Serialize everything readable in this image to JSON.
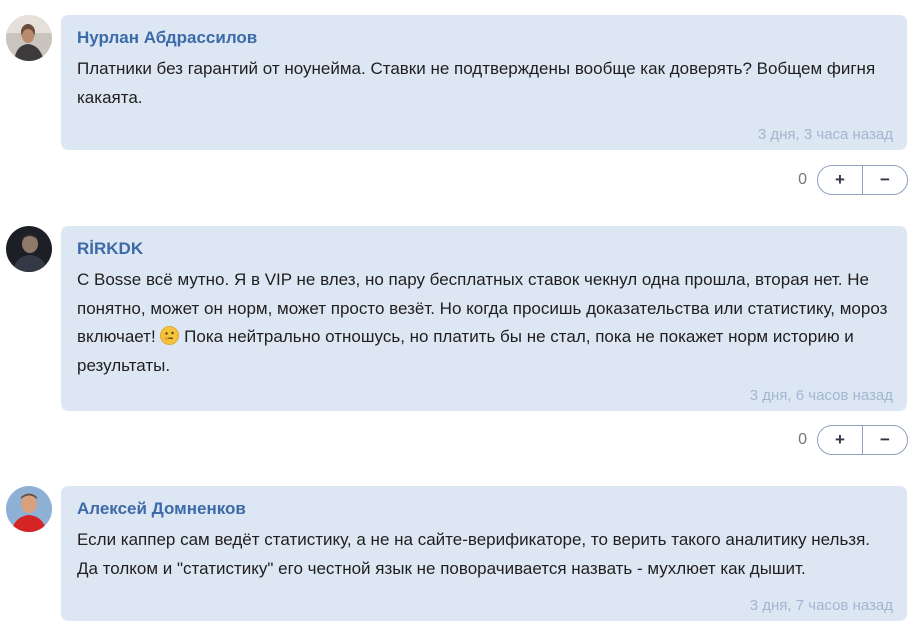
{
  "comments": [
    {
      "author": "Нурлан Абдрассилов",
      "text": "Платники без гарантий от ноунейма. Ставки не подтверждены вообще как доверять? Вобщем фигня какаята.",
      "time": "3 дня, 3 часа назад",
      "score": "0",
      "plus": "+",
      "minus": "−",
      "avatar_icon": "avatar-photo-icon"
    },
    {
      "author": "RİRKDK",
      "text_before": "С Bosse всё мутно. Я в VIP не влез, но пару бесплатных ставок чекнул одна прошла, вторая нет. Не понятно, может он норм, может просто везёт. Но когда просишь доказательства или статистику, мороз включает!",
      "emoji": "thinking-face-emoji",
      "text_after": "Пока нейтрально отношусь, но платить бы не стал, пока не покажет норм историю и результаты.",
      "time": "3 дня, 6 часов назад",
      "score": "0",
      "plus": "+",
      "minus": "−",
      "avatar_icon": "avatar-photo-icon"
    },
    {
      "author": "Алексей Домненков",
      "text": "Если каппер сам ведёт статистику, а не на сайте-верификаторе, то верить такого аналитику нельзя. Да толком и \"статистику\" его честной язык не поворачивается назвать - мухлюет как дышит.",
      "time": "3 дня, 7 часов назад",
      "avatar_icon": "avatar-photo-icon"
    }
  ],
  "colors": {
    "bubble": "#dde6f3",
    "author": "#3d6aa8",
    "timestamp": "#a3b6cf",
    "vote_border": "#8fa3bd"
  }
}
